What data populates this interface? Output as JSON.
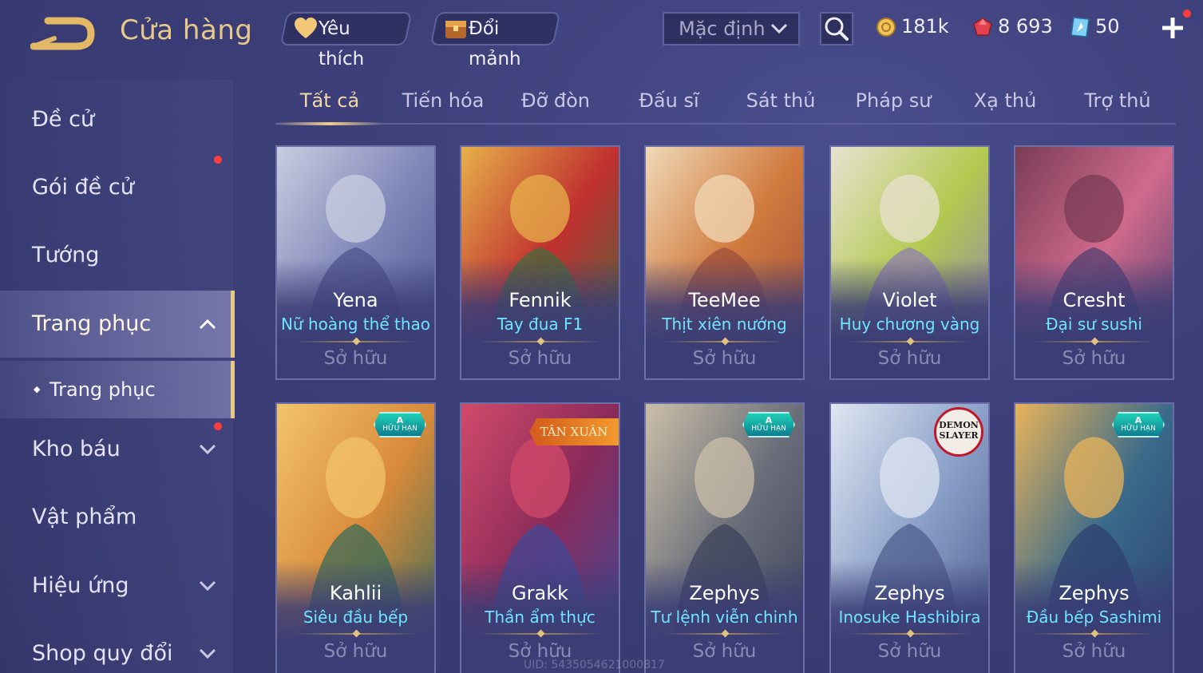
{
  "header": {
    "title": "Cửa hàng",
    "favorites_label": "Yêu thích",
    "exchange_label": "Đổi mảnh",
    "sort_value": "Mặc định",
    "gold": "181k",
    "ruby": "8 693",
    "voucher": "50"
  },
  "sidebar": {
    "items": [
      {
        "label": "Đề cử"
      },
      {
        "label": "Gói đề cử"
      },
      {
        "label": "Tướng"
      },
      {
        "label": "Trang phục"
      },
      {
        "label": "Kho báu"
      },
      {
        "label": "Vật phẩm"
      },
      {
        "label": "Hiệu ứng"
      },
      {
        "label": "Shop quy đổi"
      }
    ],
    "sub_item": "Trang phục"
  },
  "tabs": [
    "Tất cả",
    "Tiến hóa",
    "Đỡ đòn",
    "Đấu sĩ",
    "Sát thủ",
    "Pháp sư",
    "Xạ thủ",
    "Trợ thủ"
  ],
  "cards": [
    {
      "hero": "Yena",
      "skin": "Nữ hoàng thể thao",
      "status": "Sở hữu",
      "colors": [
        "#c9cde0",
        "#7f86b8",
        "#4b4f8a"
      ]
    },
    {
      "hero": "Fennik",
      "skin": "Tay đua F1",
      "status": "Sở hữu",
      "colors": [
        "#e7b04a",
        "#c0302f",
        "#3b6d3f"
      ]
    },
    {
      "hero": "TeeMee",
      "skin": "Thịt xiên nướng",
      "status": "Sở hữu",
      "colors": [
        "#f0d9b7",
        "#d07a3e",
        "#9a4b3a"
      ]
    },
    {
      "hero": "Violet",
      "skin": "Huy chương vàng",
      "status": "Sở hữu",
      "colors": [
        "#e8e2d2",
        "#b3c94f",
        "#8f7ab8"
      ]
    },
    {
      "hero": "Cresht",
      "skin": "Đại sư sushi",
      "status": "Sở hữu",
      "colors": [
        "#7a3c56",
        "#d06a8c",
        "#4a3c6e"
      ]
    },
    {
      "hero": "Kahlii",
      "skin": "Siêu đầu bếp",
      "status": "Sở hữu",
      "colors": [
        "#f2c46a",
        "#d88a3a",
        "#2f6a5a"
      ]
    },
    {
      "hero": "Grakk",
      "skin": "Thần ẩm thực",
      "status": "Sở hữu",
      "colors": [
        "#d24a6a",
        "#8a2a5a",
        "#3c4a9a"
      ]
    },
    {
      "hero": "Zephys",
      "skin": "Tư lệnh viễn chinh",
      "status": "Sở hữu",
      "colors": [
        "#cbbfa8",
        "#6a6e7a",
        "#3a3e58"
      ]
    },
    {
      "hero": "Zephys",
      "skin": "Inosuke Hashibira",
      "status": "Sở hữu",
      "colors": [
        "#dfe6f2",
        "#8aa0c8",
        "#4a5a8a"
      ]
    },
    {
      "hero": "Zephys",
      "skin": "Đầu bếp Sashimi",
      "status": "Sở hữu",
      "colors": [
        "#e9b45a",
        "#3a6a8a",
        "#2c3d6e"
      ]
    }
  ],
  "badges": {
    "limited_top": "A",
    "limited_text": "HỮU HẠN",
    "new_year": "TÂN XUÂN",
    "demon_slayer": "DEMON SLAYER"
  },
  "uid": "UID: 5435054621000817"
}
